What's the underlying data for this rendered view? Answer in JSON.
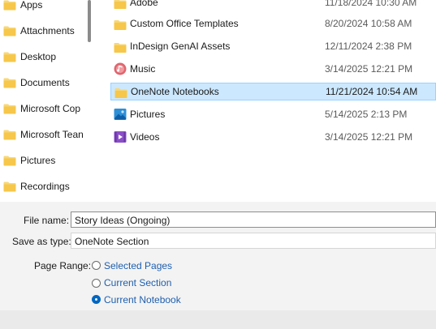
{
  "nav": {
    "items": [
      {
        "label": "Apps",
        "icon": "folder-icon"
      },
      {
        "label": "Attachments",
        "icon": "folder-icon"
      },
      {
        "label": "Desktop",
        "icon": "folder-icon"
      },
      {
        "label": "Documents",
        "icon": "folder-icon"
      },
      {
        "label": "Microsoft Cop",
        "icon": "folder-icon"
      },
      {
        "label": "Microsoft Tean",
        "icon": "folder-icon"
      },
      {
        "label": "Pictures",
        "icon": "folder-icon"
      },
      {
        "label": "Recordings",
        "icon": "folder-icon"
      }
    ]
  },
  "files": {
    "rows": [
      {
        "name": "Adobe",
        "date": "11/18/2024 10:30 AM",
        "icon": "folder-icon"
      },
      {
        "name": "Custom Office Templates",
        "date": "8/20/2024 10:58 AM",
        "icon": "folder-icon"
      },
      {
        "name": "InDesign GenAI Assets",
        "date": "12/11/2024 2:38 PM",
        "icon": "folder-icon"
      },
      {
        "name": "Music",
        "date": "3/14/2025 12:21 PM",
        "icon": "music-icon"
      },
      {
        "name": "OneNote Notebooks",
        "date": "11/21/2024 10:54 AM",
        "icon": "folder-icon",
        "selected": true
      },
      {
        "name": "Pictures",
        "date": "5/14/2025 2:13 PM",
        "icon": "pictures-icon"
      },
      {
        "name": "Videos",
        "date": "3/14/2025 12:21 PM",
        "icon": "videos-icon"
      }
    ]
  },
  "form": {
    "file_name_label": "File name:",
    "file_name_value": "Story Ideas (Ongoing)",
    "save_type_label": "Save as type:",
    "save_type_value": "OneNote Section",
    "page_range_label": "Page Range:",
    "options": [
      {
        "label": "Selected Pages",
        "checked": false
      },
      {
        "label": "Current Section",
        "checked": false
      },
      {
        "label": "Current Notebook",
        "checked": true
      }
    ]
  },
  "colors": {
    "accent": "#0067c0",
    "selection": "#cce8ff",
    "folder": "#f6c74a"
  }
}
